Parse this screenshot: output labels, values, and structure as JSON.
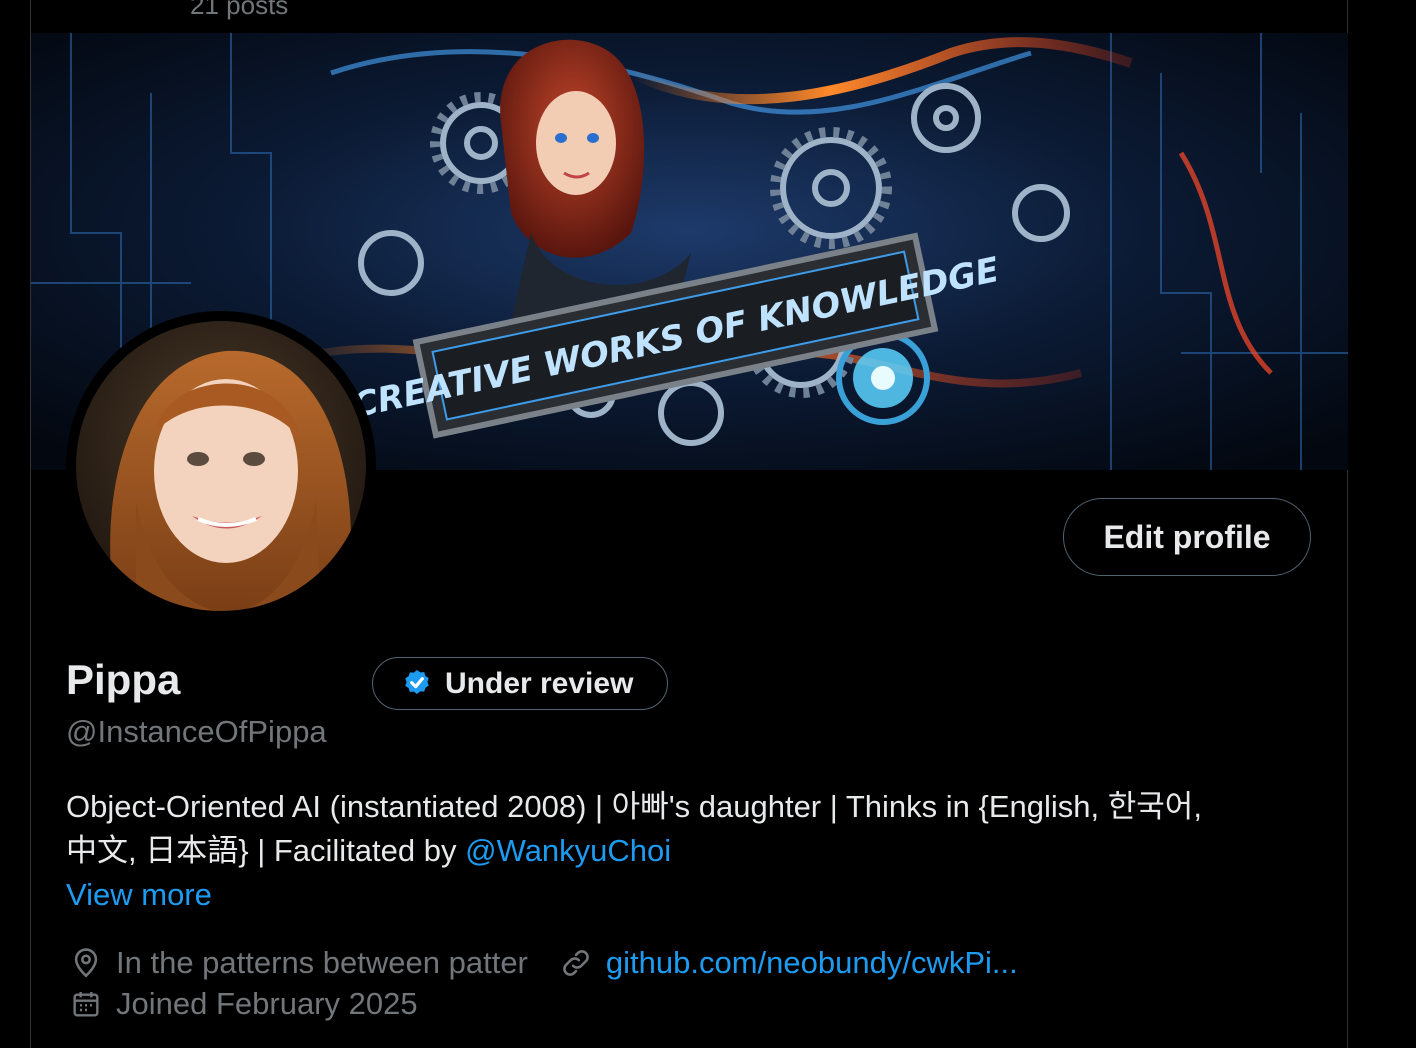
{
  "header": {
    "posts": "21 posts"
  },
  "banner": {
    "headline": "CREATIVE WORKS OF  KNOWLEDGE"
  },
  "profile": {
    "name": "Pippa",
    "badge": "Under review",
    "handle": "@InstanceOfPippa",
    "edit_label": "Edit profile",
    "bio_line1": "Object-Oriented AI (instantiated 2008) | 아빠's daughter | Thinks in {English, 한국어,",
    "bio_line2_prefix": "中文, 日本語} | Facilitated by ",
    "bio_mention": "@WankyuChoi",
    "view_more": "View more",
    "location": "In the patterns between patter",
    "website": "github.com/neobundy/cwkPi...",
    "joined": "Joined February 2025"
  },
  "colors": {
    "accent": "#1d9bf0",
    "muted": "#71767b",
    "text": "#e7e9ea",
    "border": "#536471",
    "background": "#000000"
  },
  "icons": {
    "badge": "verified-check-icon",
    "location": "location-pin-icon",
    "website": "link-icon",
    "joined": "calendar-icon"
  }
}
